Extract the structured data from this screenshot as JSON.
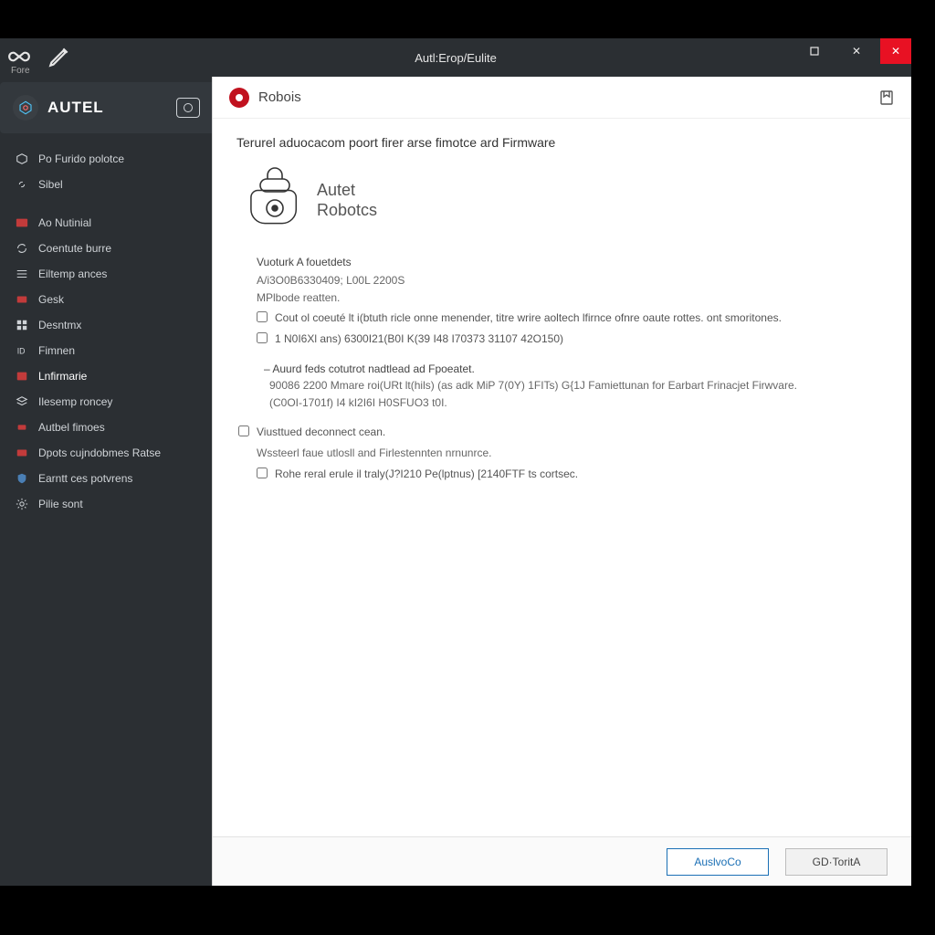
{
  "titlebar": {
    "toolLabel": "Fore",
    "title": "Autl:Erop/Eulite"
  },
  "brand": {
    "name": "AUTEL"
  },
  "nav": {
    "group1": [
      {
        "label": "Po Furido polotce"
      },
      {
        "label": "Sibel"
      }
    ],
    "group2": [
      {
        "label": "Ao Nutinial"
      },
      {
        "label": "Coentute burre"
      },
      {
        "label": "Eiltemp ances"
      },
      {
        "label": "Gesk"
      },
      {
        "label": "Desntmx"
      },
      {
        "label": "Fimnen"
      },
      {
        "label": "Lnfirmarie"
      },
      {
        "label": "Ilesemp roncey"
      },
      {
        "label": "Autbel fimoes"
      },
      {
        "label": "Dpots cujndobmes Ratse"
      },
      {
        "label": "Earntt ces potvrens"
      },
      {
        "label": "Pilie sont"
      }
    ]
  },
  "main": {
    "heading": "Robois",
    "subtitle": "Terurel aduocacom poort firer arse fimotce ard Firmware",
    "productName1": "Autet",
    "productName2": "Robotcs",
    "block1": {
      "head": "Vuoturk A fouetdets",
      "line1": "A/i3O0B6330409; L00L 2200S",
      "line2": "MPlbode reatten.",
      "chk1": "Cout ol coeuté lt i(btuth ricle onne menender, titre wrire aoltech lfirnce ofnre oaute rottes. ont smoritones.",
      "chk2": "1 N0I6Xl ans) 6300I21(B0I K(39 I48 I70373 31107 42O150)"
    },
    "block2": {
      "dash": "– Auurd feds cotutrot nadtlead ad Fpoeatet.",
      "line1": "90086 2200 Mmare roi(URt lt(hils) (as adk MiP 7(0Y) 1FITs) G{1J Famiettunan for Earbart Frinacjet Firwvare.",
      "line2": "(C0OI-1701f) I4 kI2I6I H0SFUO3 t0I."
    },
    "block3": {
      "chk1": "Viusttued deconnect cean.",
      "line1": "Wssteerl faue utlosll and Firlestennten nrnunrce.",
      "chk2": "Rohe reral erule il traly(J?I210 Pe(lptnus) [2140FTF ts cortsec."
    }
  },
  "footer": {
    "primary": "AuslvoCo",
    "secondary": "GD·ToritA"
  }
}
